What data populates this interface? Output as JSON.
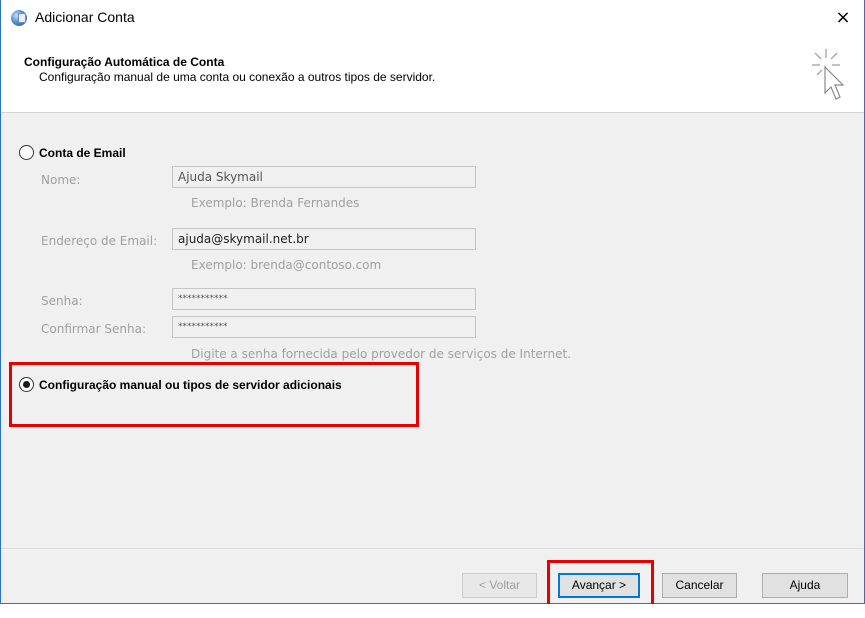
{
  "window": {
    "title": "Adicionar Conta",
    "close_glyph": "×"
  },
  "header": {
    "title": "Configuração Automática de Conta",
    "subtitle": "Configuração manual de uma conta ou conexão a outros tipos de servidor.",
    "icon": "cursor-sparkle-icon"
  },
  "options": {
    "email_account": {
      "label": "Conta de Email",
      "selected": false
    },
    "manual_config": {
      "label": "Configuração manual ou tipos de servidor adicionais",
      "selected": true
    }
  },
  "form": {
    "name": {
      "label": "Nome:",
      "value": "Ajuda Skymail",
      "hint": "Exemplo: Brenda Fernandes"
    },
    "email": {
      "label": "Endereço de Email:",
      "value": "ajuda@skymail.net.br",
      "hint": "Exemplo: brenda@contoso.com"
    },
    "password": {
      "label": "Senha:",
      "value": "***********"
    },
    "confirm_password": {
      "label": "Confirmar Senha:",
      "value": "***********"
    },
    "password_hint": "Digite a senha fornecida pelo provedor de serviços de Internet."
  },
  "buttons": {
    "back": "< Voltar",
    "next": "Avançar >",
    "cancel": "Cancelar",
    "help": "Ajuda"
  },
  "colors": {
    "highlight": "#e60000",
    "accent": "#0078d7"
  }
}
